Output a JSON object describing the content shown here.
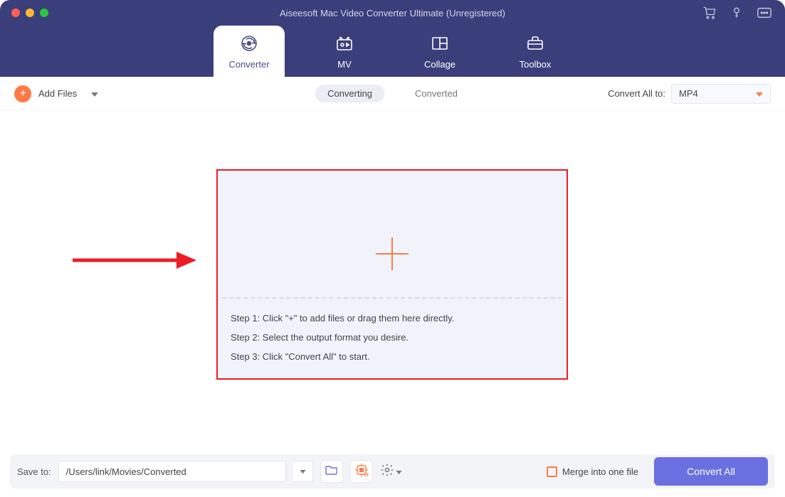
{
  "window": {
    "title": "Aiseesoft Mac Video Converter Ultimate (Unregistered)"
  },
  "tabs": [
    {
      "label": "Converter"
    },
    {
      "label": "MV"
    },
    {
      "label": "Collage"
    },
    {
      "label": "Toolbox"
    }
  ],
  "toolbar": {
    "add_files_label": "Add Files",
    "filter": {
      "converting": "Converting",
      "converted": "Converted"
    },
    "convert_all_to_label": "Convert All to:",
    "format_selected": "MP4"
  },
  "dropzone": {
    "steps": [
      "Step 1: Click \"+\" to add files or drag them here directly.",
      "Step 2: Select the output format you desire.",
      "Step 3: Click \"Convert All\" to start."
    ]
  },
  "bottombar": {
    "save_to_label": "Save to:",
    "path": "/Users/link/Movies/Converted",
    "merge_label": "Merge into one file",
    "convert_all_label": "Convert All"
  },
  "colors": {
    "accent_orange": "#ff7a45",
    "accent_purple": "#6a70e0",
    "header_bg": "#3a3e7a",
    "annotation_red": "#ed1c24"
  }
}
